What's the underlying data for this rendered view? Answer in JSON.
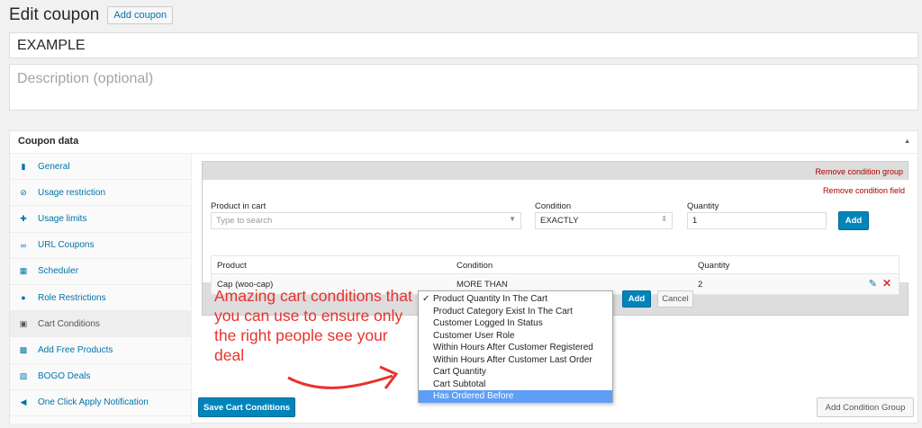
{
  "header": {
    "title": "Edit coupon",
    "add_coupon_label": "Add coupon"
  },
  "coupon_code": "EXAMPLE",
  "description_placeholder": "Description (optional)",
  "panel": {
    "title": "Coupon data"
  },
  "tabs": [
    {
      "label": "General",
      "icon": "ticket-icon"
    },
    {
      "label": "Usage restriction",
      "icon": "no-entry-icon"
    },
    {
      "label": "Usage limits",
      "icon": "move-arrows-icon"
    },
    {
      "label": "URL Coupons",
      "icon": "link-icon"
    },
    {
      "label": "Scheduler",
      "icon": "calendar-icon"
    },
    {
      "label": "Role Restrictions",
      "icon": "user-icon"
    },
    {
      "label": "Cart Conditions",
      "icon": "cart-icon",
      "active": true
    },
    {
      "label": "Add Free Products",
      "icon": "gift-icon"
    },
    {
      "label": "BOGO Deals",
      "icon": "tag-icon"
    },
    {
      "label": "One Click Apply Notification",
      "icon": "megaphone-icon"
    }
  ],
  "condition_group": {
    "remove_group_label": "Remove condition group",
    "remove_field_label": "Remove condition field",
    "product_label": "Product in cart",
    "product_placeholder": "Type to search",
    "condition_label": "Condition",
    "condition_value": "EXACTLY",
    "quantity_label": "Quantity",
    "quantity_value": "1",
    "add_label": "Add",
    "table": {
      "headers": [
        "Product",
        "Condition",
        "Quantity"
      ],
      "rows": [
        {
          "product": "Cap (woo-cap)",
          "condition": "MORE THAN",
          "quantity": "2"
        }
      ]
    },
    "bottom_add_label": "Add",
    "cancel_label": "Cancel"
  },
  "dropdown_options": [
    "Product Quantity In The Cart",
    "Product Category Exist In The Cart",
    "Customer Logged In Status",
    "Customer User Role",
    "Within Hours After Customer Registered",
    "Within Hours After Customer Last Order",
    "Cart Quantity",
    "Cart Subtotal",
    "Has Ordered Before"
  ],
  "dropdown_selected": "Product Quantity In The Cart",
  "dropdown_highlighted": "Has Ordered Before",
  "annotation": "Amazing cart conditions that you can use to ensure only the right people see your deal",
  "footer": {
    "save_label": "Save Cart Conditions",
    "add_group_label": "Add Condition Group"
  },
  "colors": {
    "accent": "#0085ba",
    "danger": "#a00",
    "annotation": "#e8322d",
    "highlight": "#5f9ef5"
  }
}
